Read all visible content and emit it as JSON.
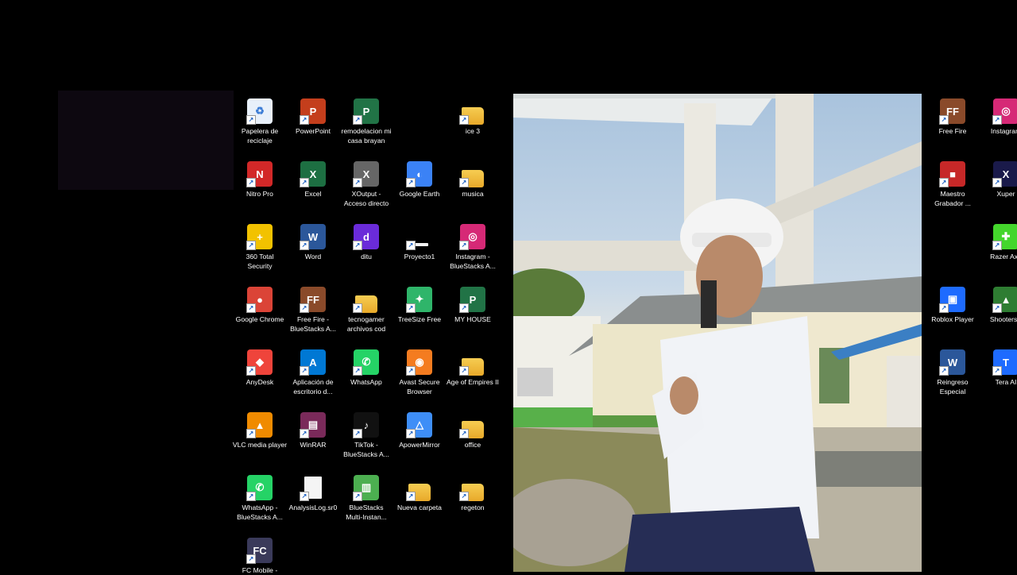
{
  "desktop": {
    "icons_col1": [
      {
        "label": "Papelera de\nreciclaje",
        "icon": "recycle-bin-icon",
        "color": "#e8f0fa"
      },
      {
        "label": "Nitro Pro",
        "icon": "nitro-pro-icon",
        "color": "#d22828"
      },
      {
        "label": "360 Total\nSecurity",
        "icon": "360-security-icon",
        "color": "#f2c200"
      },
      {
        "label": "Google Chrome",
        "icon": "chrome-icon",
        "color": "#db4437"
      },
      {
        "label": "AnyDesk",
        "icon": "anydesk-icon",
        "color": "#ef443b"
      },
      {
        "label": "VLC media player",
        "icon": "vlc-icon",
        "color": "#f08b00"
      },
      {
        "label": "WhatsApp -\nBlueStacks A...",
        "icon": "whatsapp-bluestacks-icon",
        "color": "#25d366"
      },
      {
        "label": "FC Mobile -",
        "icon": "fc-mobile-icon",
        "color": "#3a3a5a"
      }
    ],
    "icons_col2": [
      {
        "label": "PowerPoint",
        "icon": "powerpoint-icon",
        "color": "#c43e1c"
      },
      {
        "label": "Excel",
        "icon": "excel-icon",
        "color": "#1d6f42"
      },
      {
        "label": "Word",
        "icon": "word-icon",
        "color": "#2b579a"
      },
      {
        "label": "Free Fire -\nBlueStacks A...",
        "icon": "free-fire-icon",
        "color": "#8a4a2a"
      },
      {
        "label": "Aplicación de\nescritorio d...",
        "icon": "azure-icon",
        "color": "#0078d4"
      },
      {
        "label": "WinRAR",
        "icon": "winrar-icon",
        "color": "#7a2a5a"
      },
      {
        "label": "AnalysisLog.sr0",
        "icon": "file-icon",
        "color": "#f4f4f4"
      }
    ],
    "icons_col3": [
      {
        "label": "remodelacion mi\ncasa brayan",
        "icon": "project-file-icon",
        "color": "#217346"
      },
      {
        "label": "XOutput -\nAcceso directo",
        "icon": "xoutput-icon",
        "color": "#666666"
      },
      {
        "label": "ditu",
        "icon": "ditu-icon",
        "color": "#6a2bd9"
      },
      {
        "label": "tecnogamer\narchivos cod",
        "icon": "folder-icon",
        "color": "#f0b935"
      },
      {
        "label": "WhatsApp",
        "icon": "whatsapp-icon",
        "color": "#25d366"
      },
      {
        "label": "TikTok -\nBlueStacks A...",
        "icon": "tiktok-icon",
        "color": "#111111"
      },
      {
        "label": "BlueStacks\nMulti-Instan...",
        "icon": "bluestacks-icon",
        "color": "#4caf50"
      }
    ],
    "icons_col4": [
      {
        "label": "Google Earth",
        "icon": "google-earth-icon",
        "color": "#3b82f6"
      },
      {
        "label": "Proyecto1",
        "icon": "blank-file-icon",
        "color": "#ffffff"
      },
      {
        "label": "TreeSize Free",
        "icon": "treesize-icon",
        "color": "#2fb56a"
      },
      {
        "label": "Avast Secure\nBrowser",
        "icon": "avast-browser-icon",
        "color": "#f47c20"
      },
      {
        "label": "ApowerMirror",
        "icon": "apowermirror-icon",
        "color": "#3e8ef7"
      },
      {
        "label": "Nueva carpeta",
        "icon": "folder-icon",
        "color": "#f0b935"
      }
    ],
    "icons_col5": [
      {
        "label": "ice 3",
        "icon": "folder-icon",
        "color": "#f0b935"
      },
      {
        "label": "musica",
        "icon": "folder-icon",
        "color": "#f0b935"
      },
      {
        "label": "Instagram -\nBlueStacks A...",
        "icon": "instagram-icon",
        "color": "#d62976"
      },
      {
        "label": "MY HOUSE",
        "icon": "project-file-icon",
        "color": "#217346"
      },
      {
        "label": "Age of Empires II",
        "icon": "folder-icon",
        "color": "#f0b935"
      },
      {
        "label": "office",
        "icon": "folder-icon",
        "color": "#f0b935"
      },
      {
        "label": "regeton",
        "icon": "folder-icon",
        "color": "#f0b935"
      }
    ],
    "icons_right1": [
      {
        "label": "Free Fire",
        "icon": "free-fire-icon",
        "color": "#8a4a2a"
      },
      {
        "label": "Maestro\nGrabador ...",
        "icon": "recorder-icon",
        "color": "#c62828"
      },
      {
        "label": "",
        "icon": "",
        "color": ""
      },
      {
        "label": "Roblox Player",
        "icon": "roblox-icon",
        "color": "#1e6bff"
      },
      {
        "label": "Reingreso\nEspecial",
        "icon": "word-doc-icon",
        "color": "#2b579a"
      }
    ],
    "icons_right2": [
      {
        "label": "Instagram",
        "icon": "instagram-icon",
        "color": "#d62976"
      },
      {
        "label": "Xuper",
        "icon": "xuper-icon",
        "color": "#1a1a4a"
      },
      {
        "label": "Razer Axo",
        "icon": "razer-icon",
        "color": "#44d62c"
      },
      {
        "label": "ShootersP",
        "icon": "shooters-icon",
        "color": "#2e7d32"
      },
      {
        "label": "Tera AI",
        "icon": "tera-ai-icon",
        "color": "#1e6bff"
      }
    ]
  }
}
